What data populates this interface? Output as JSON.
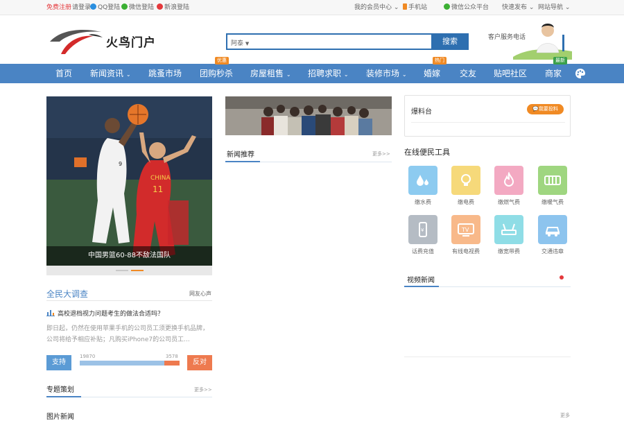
{
  "topbar": {
    "register": "免费注册",
    "login": "请登录",
    "qq": "QQ登陆",
    "wechat": "微信登陆",
    "weibo": "新浪登陆",
    "member_center": "我的会员中心",
    "mobile": "手机站",
    "wechat_official": "微信公众平台",
    "quick_post": "快速发布",
    "site_nav": "网站导航"
  },
  "header": {
    "site_name": "火鸟门户",
    "search_scope": "阿泰",
    "search_value": "",
    "search_button": "搜索",
    "service_label": "客户服务电话"
  },
  "nav": {
    "items": [
      {
        "label": "首页",
        "badge": ""
      },
      {
        "label": "新闻资讯",
        "badge": "",
        "arrow": true
      },
      {
        "label": "跳蚤市场",
        "badge": ""
      },
      {
        "label": "团购秒杀",
        "badge": "优惠"
      },
      {
        "label": "房屋租售",
        "badge": "",
        "arrow": true
      },
      {
        "label": "招聘求职",
        "badge": "",
        "arrow": true
      },
      {
        "label": "装修市场",
        "badge": "",
        "arrow": true
      },
      {
        "label": "婚嫁",
        "badge": "热门"
      },
      {
        "label": "交友",
        "badge": ""
      },
      {
        "label": "贴吧社区",
        "badge": ""
      },
      {
        "label": "商家",
        "badge": "最新"
      }
    ]
  },
  "hero": {
    "caption": "中国男篮60-88不敌法国队"
  },
  "survey": {
    "title": "全民大调查",
    "more": "网友心声",
    "question": "高校退档视力问题考生的做法合适吗？",
    "description": "即日起，仍然在使用苹果手机的公司员工须更换手机品牌，公司将给予相应补贴；凡购买iPhone7的公司员工...",
    "support_label": "支持",
    "oppose_label": "反对",
    "support_count": "19870",
    "oppose_count": "3578",
    "support_ratio": 0.8474
  },
  "special": {
    "title": "专题策划",
    "more": "更多>>"
  },
  "photo_news": {
    "title": "图片新闻",
    "more": "更多"
  },
  "news": {
    "title": "新闻推荐",
    "more": "更多>>"
  },
  "tipbox": {
    "title": "爆料台",
    "button": "我要投料"
  },
  "tools": {
    "title": "在线便民工具",
    "items": [
      {
        "label": "缴水费",
        "icon": "water-drop-icon",
        "color": "#8dcbf0"
      },
      {
        "label": "缴电费",
        "icon": "lightbulb-icon",
        "color": "#f6d97a"
      },
      {
        "label": "缴燃气费",
        "icon": "flame-icon",
        "color": "#f3a9c2"
      },
      {
        "label": "缴暖气费",
        "icon": "radiator-icon",
        "color": "#9fd680"
      },
      {
        "label": "话费充值",
        "icon": "phone-icon",
        "color": "#b5bcc4"
      },
      {
        "label": "有线电视费",
        "icon": "tv-icon",
        "color": "#f8b98a"
      },
      {
        "label": "缴宽带费",
        "icon": "router-icon",
        "color": "#8fdde6"
      },
      {
        "label": "交通违章",
        "icon": "car-icon",
        "color": "#8dc4ee"
      }
    ]
  },
  "video_news": {
    "title": "视频新闻"
  }
}
